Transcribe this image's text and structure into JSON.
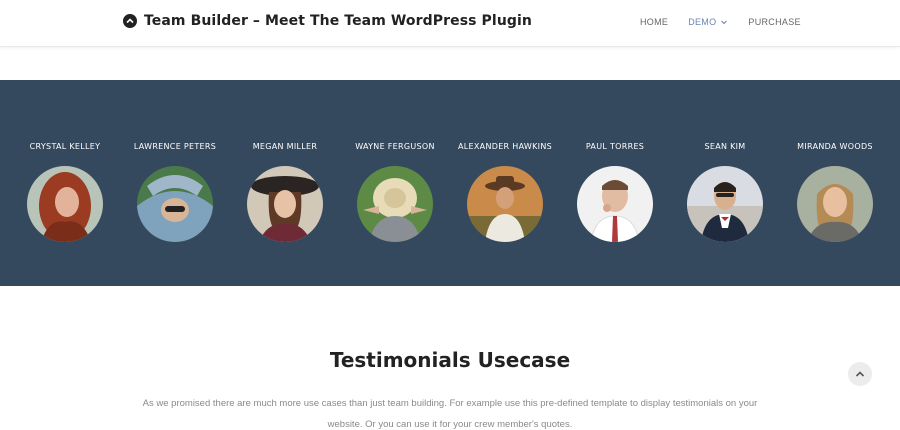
{
  "header": {
    "brand_icon": "chevron-up-circle-icon",
    "title": "Team Builder – Meet The Team WordPress Plugin",
    "nav": [
      {
        "label": "HOME",
        "active": false
      },
      {
        "label": "DEMO",
        "active": true,
        "has_dropdown": true
      },
      {
        "label": "PURCHASE",
        "active": false
      }
    ]
  },
  "team": {
    "background_color": "#34495e",
    "members": [
      {
        "name": "CRYSTAL KELLEY"
      },
      {
        "name": "LAWRENCE PETERS"
      },
      {
        "name": "MEGAN MILLER"
      },
      {
        "name": "WAYNE FERGUSON"
      },
      {
        "name": "ALEXANDER HAWKINS"
      },
      {
        "name": "PAUL TORRES"
      },
      {
        "name": "SEAN KIM"
      },
      {
        "name": "MIRANDA WOODS"
      }
    ]
  },
  "testimonials": {
    "title": "Testimonials Usecase",
    "text_line1": "As we promised there are much more use cases than just team building. For example use this pre-defined template to display testimonials on your",
    "text_line2": "website. Or you can use it for your crew member's quotes."
  },
  "scroll_top_icon": "chevron-up-icon"
}
